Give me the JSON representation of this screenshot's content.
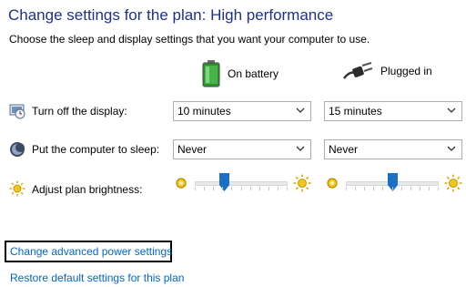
{
  "header": {
    "title": "Change settings for the plan: High performance",
    "subtitle": "Choose the sleep and display settings that you want your computer to use."
  },
  "columns": {
    "battery_label": "On battery",
    "plugged_label": "Plugged in"
  },
  "rows": {
    "display": {
      "label": "Turn off the display:",
      "battery_value": "10 minutes",
      "plugged_value": "15 minutes"
    },
    "sleep": {
      "label": "Put the computer to sleep:",
      "battery_value": "Never",
      "plugged_value": "Never"
    },
    "brightness": {
      "label": "Adjust plan brightness:",
      "battery_level": 0.3,
      "plugged_level": 0.5
    }
  },
  "links": {
    "advanced": "Change advanced power settings",
    "restore": "Restore default settings for this plan"
  },
  "colors": {
    "title": "#1e3287",
    "link": "#0066cc",
    "slider_thumb": "#1c6fc7",
    "battery_green": "#3aa43a"
  }
}
